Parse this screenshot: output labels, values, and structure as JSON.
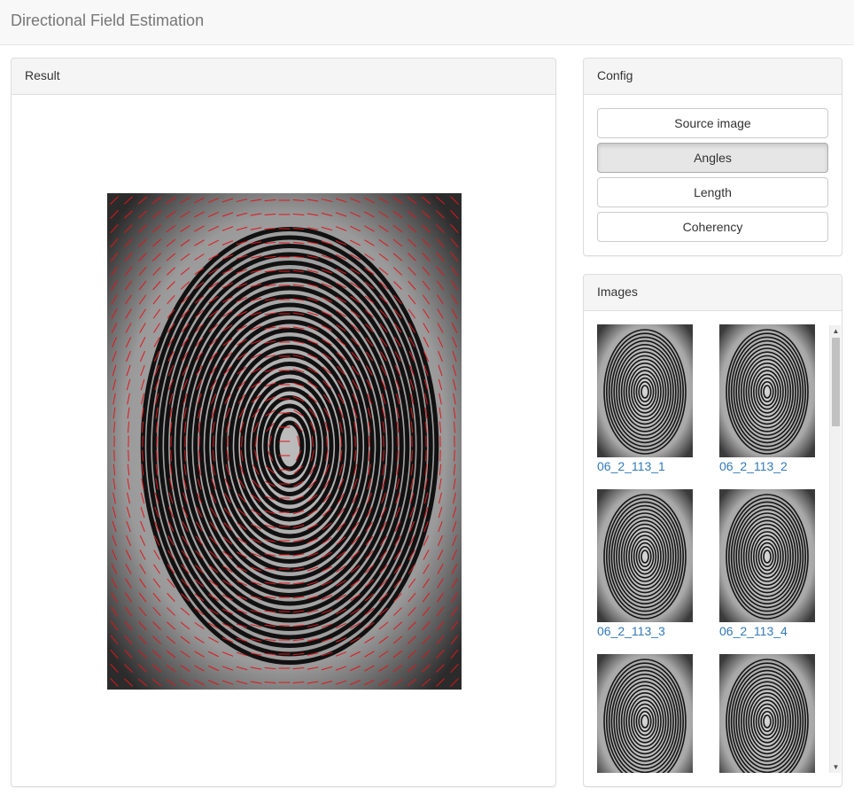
{
  "navbar": {
    "brand": "Directional Field Estimation"
  },
  "result": {
    "heading": "Result",
    "image_alt": "fingerprint-with-orientation-field"
  },
  "config": {
    "heading": "Config",
    "buttons": [
      {
        "label": "Source image",
        "active": false
      },
      {
        "label": "Angles",
        "active": true
      },
      {
        "label": "Length",
        "active": false
      },
      {
        "label": "Coherency",
        "active": false
      }
    ]
  },
  "images": {
    "heading": "Images",
    "items": [
      {
        "label": "06_2_113_1"
      },
      {
        "label": "06_2_113_2"
      },
      {
        "label": "06_2_113_3"
      },
      {
        "label": "06_2_113_4"
      },
      {
        "label": ""
      },
      {
        "label": ""
      }
    ]
  },
  "colors": {
    "link": "#337ab7",
    "field_lines": "#e0151b",
    "panel_heading_bg": "#f5f5f5"
  },
  "icons": {
    "scroll_up": "triangle-up-icon",
    "scroll_down": "triangle-down-icon"
  }
}
